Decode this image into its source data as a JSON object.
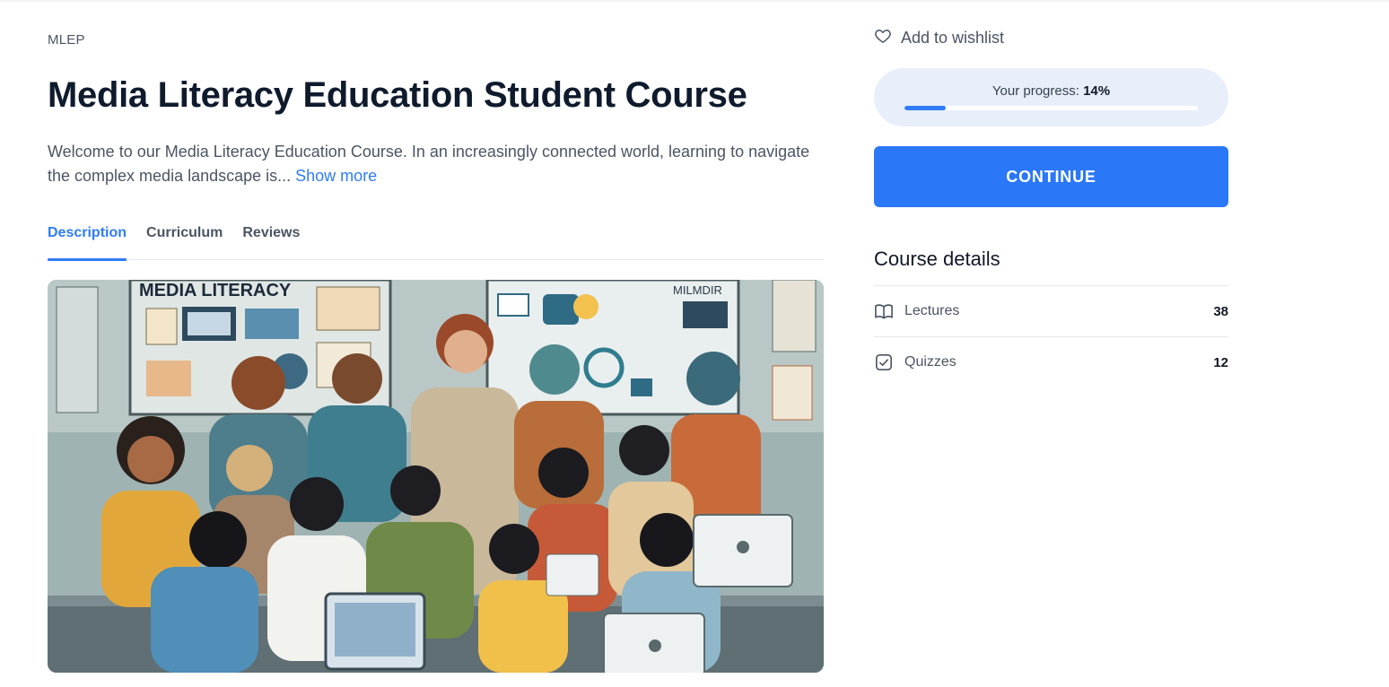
{
  "course": {
    "category": "MLEP",
    "title": "Media Literacy Education Student Course",
    "description": "Welcome to our Media Literacy Education Course. In an increasingly connected world, learning to navigate the complex media landscape is... ",
    "show_more": "Show more"
  },
  "tabs": [
    {
      "label": "Description",
      "active": true
    },
    {
      "label": "Curriculum",
      "active": false
    },
    {
      "label": "Reviews",
      "active": false
    }
  ],
  "hero": {
    "banner_text": "MEDIA LITERACY",
    "screen_text": "MILMDIR"
  },
  "sidebar": {
    "wishlist_label": "Add to wishlist",
    "progress_label": "Your progress: ",
    "progress_value": "14%",
    "progress_fraction": 0.14,
    "continue_label": "CONTINUE",
    "details_title": "Course details",
    "details": [
      {
        "label": "Lectures",
        "count": "38",
        "icon": "book-icon"
      },
      {
        "label": "Quizzes",
        "count": "12",
        "icon": "checkbox-icon"
      }
    ]
  },
  "colors": {
    "accent": "#2f7cf6",
    "progress_bg": "#e8effb",
    "title": "#0f1b2d"
  }
}
